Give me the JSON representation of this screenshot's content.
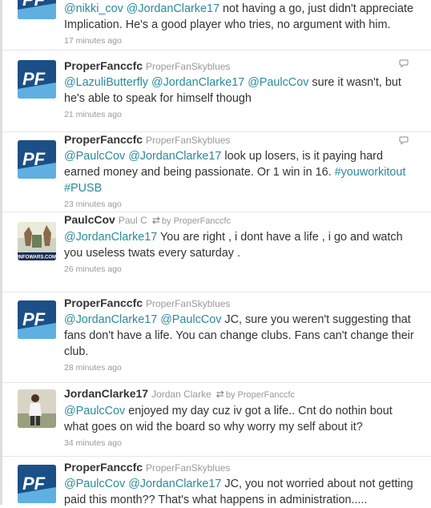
{
  "tweets": [
    {
      "screen_name": "",
      "full_name": "",
      "text_parts": [
        {
          "t": "@nikki_cov",
          "k": "mention"
        },
        {
          "t": " ",
          "k": "plain"
        },
        {
          "t": "@JordanClarke17",
          "k": "mention"
        },
        {
          "t": " not having a go, just didn't appreciate Implication. He's a good player who tries, no argument with him.",
          "k": "plain"
        }
      ],
      "time": "17 minutes ago"
    },
    {
      "screen_name": "ProperFanccfc",
      "full_name": "ProperFanSkyblues",
      "text_parts": [
        {
          "t": "@LazuliButterfly",
          "k": "mention"
        },
        {
          "t": " ",
          "k": "plain"
        },
        {
          "t": "@JordanClarke17",
          "k": "mention"
        },
        {
          "t": " ",
          "k": "plain"
        },
        {
          "t": "@PaulcCov",
          "k": "mention"
        },
        {
          "t": " sure it wasn't, but he's able to speak for himself though",
          "k": "plain"
        }
      ],
      "time": "21 minutes ago"
    },
    {
      "screen_name": "ProperFanccfc",
      "full_name": "ProperFanSkyblues",
      "text_parts": [
        {
          "t": "@PaulcCov",
          "k": "mention"
        },
        {
          "t": " ",
          "k": "plain"
        },
        {
          "t": "@JordanClarke17",
          "k": "mention"
        },
        {
          "t": " look up losers, is it paying hard earned money and being passionate. Or 1 win in 16. ",
          "k": "plain"
        },
        {
          "t": "#youworkitout",
          "k": "hashtag"
        },
        {
          "t": " ",
          "k": "plain"
        },
        {
          "t": "#PUSB",
          "k": "hashtag"
        }
      ],
      "time": "23 minutes ago"
    },
    {
      "screen_name": "PaulcCov",
      "full_name": "Paul C",
      "retweeted_by": "by ProperFanccfc",
      "text_parts": [
        {
          "t": "@JordanClarke17",
          "k": "mention"
        },
        {
          "t": " You are right , i dont have a life , i go and watch you useless twats every saturday .",
          "k": "plain"
        }
      ],
      "time": "26 minutes ago",
      "avatar_caption": "INFOWARS.COM"
    },
    {
      "screen_name": "ProperFanccfc",
      "full_name": "ProperFanSkyblues",
      "text_parts": [
        {
          "t": "@JordanClarke17",
          "k": "mention"
        },
        {
          "t": " ",
          "k": "plain"
        },
        {
          "t": "@PaulcCov",
          "k": "mention"
        },
        {
          "t": " JC, sure you weren't suggesting that fans don't have a life. You can change clubs. Fans can't change their club.",
          "k": "plain"
        }
      ],
      "time": "28 minutes ago"
    },
    {
      "screen_name": "JordanClarke17",
      "full_name": "Jordan Clarke",
      "retweeted_by": "by ProperFanccfc",
      "text_parts": [
        {
          "t": "@PaulcCov",
          "k": "mention"
        },
        {
          "t": " enjoyed my day cuz iv got a life.. Cnt do nothin bout what goes on wid the board so why worry my self about it?",
          "k": "plain"
        }
      ],
      "time": "34 minutes ago"
    },
    {
      "screen_name": "ProperFanccfc",
      "full_name": "ProperFanSkyblues",
      "text_parts": [
        {
          "t": "@PaulcCov",
          "k": "mention"
        },
        {
          "t": " ",
          "k": "plain"
        },
        {
          "t": "@JordanClarke17",
          "k": "mention"
        },
        {
          "t": " JC, you not worried about not getting paid this month?? That's what happens in administration.....",
          "k": "plain"
        }
      ],
      "time": ""
    }
  ],
  "avatar_logo_text": "PF",
  "icons": {
    "reply": "reply-icon",
    "retweet": "retweet-icon"
  },
  "colors": {
    "link": "#2a8a9c",
    "pf_blue": "#1b4f86",
    "sky": "#5fb0e0"
  }
}
